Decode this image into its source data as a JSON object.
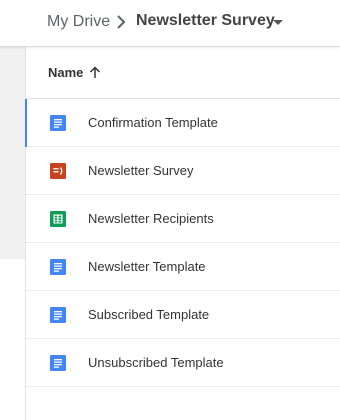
{
  "breadcrumb": {
    "root": "My Drive",
    "current": "Newsletter Survey"
  },
  "list": {
    "header": {
      "name_label": "Name",
      "sort_direction": "ascending"
    },
    "rows": [
      {
        "name": "Confirmation Template",
        "type": "doc",
        "selected": true
      },
      {
        "name": "Newsletter Survey",
        "type": "form",
        "selected": false
      },
      {
        "name": "Newsletter Recipients",
        "type": "sheet",
        "selected": false
      },
      {
        "name": "Newsletter Template",
        "type": "doc",
        "selected": false
      },
      {
        "name": "Subscribed Template",
        "type": "doc",
        "selected": false
      },
      {
        "name": "Unsubscribed Template",
        "type": "doc",
        "selected": false
      }
    ]
  },
  "colors": {
    "doc": "#4285f4",
    "form": "#c8431d",
    "sheet": "#0f9d58",
    "selection": "#4285f4"
  },
  "icons": {
    "doc": "docs-icon",
    "form": "forms-icon",
    "sheet": "sheets-icon"
  }
}
